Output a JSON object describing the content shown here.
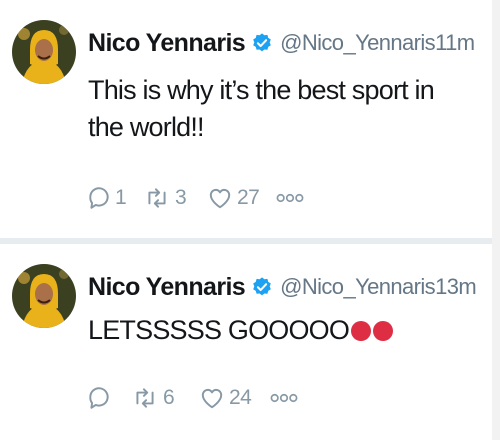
{
  "tweets": [
    {
      "name": "Nico Yennaris",
      "handle": "@Nico_Yennaris",
      "time": "11m",
      "text": "This is why it’s the best sport in the world!!",
      "replies": "1",
      "retweets": "3",
      "likes": "27"
    },
    {
      "name": "Nico Yennaris",
      "handle": "@Nico_Yennaris",
      "time": "13m",
      "text": "LETSSSSS GOOOOO",
      "replies": "",
      "retweets": "6",
      "likes": "24"
    }
  ],
  "colors": {
    "text": "#14171a",
    "secondary": "#657786",
    "icon": "#8899a6",
    "verified": "#1da1f2",
    "separator": "#e6ecf0",
    "red-circle": "#dd2e44"
  },
  "icons": {
    "verified": "verified-badge-icon",
    "reply": "reply-icon",
    "retweet": "retweet-icon",
    "like": "heart-icon",
    "more": "more-dots-icon",
    "emoji": "red-circle-icon"
  }
}
